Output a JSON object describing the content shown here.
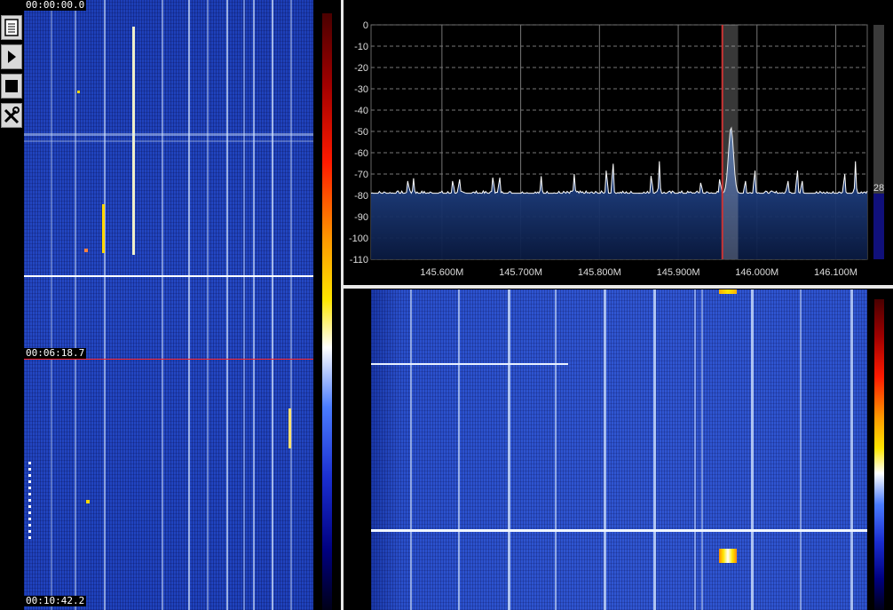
{
  "timestamps": {
    "t0": "00:00:00.0",
    "t1": "00:06:18.7",
    "t2": "00:10:42.2"
  },
  "toolbar": {
    "buttons": [
      {
        "name": "log-button",
        "icon": "document-icon"
      },
      {
        "name": "play-button",
        "icon": "play-icon"
      },
      {
        "name": "stop-button",
        "icon": "stop-icon"
      },
      {
        "name": "settings-button",
        "icon": "tools-icon"
      }
    ]
  },
  "spectrum": {
    "y_ticks": [
      "0",
      "-10",
      "-20",
      "-30",
      "-40",
      "-50",
      "-60",
      "-70",
      "-80",
      "-90",
      "-100",
      "-110"
    ],
    "x_ticks": [
      "145.600M",
      "145.700M",
      "145.800M",
      "145.900M",
      "146.000M",
      "146.100M"
    ],
    "level_value": "28",
    "selection_color": "#cc3333"
  },
  "chart_data": {
    "type": "line",
    "title": "",
    "xlabel": "",
    "ylabel": "",
    "xlim": [
      145.51,
      146.14
    ],
    "ylim": [
      -110,
      0
    ],
    "grid": true,
    "noise_floor_db": -79,
    "peaks": [
      {
        "freq": 145.557,
        "db": -72
      },
      {
        "freq": 145.564,
        "db": -72
      },
      {
        "freq": 145.614,
        "db": -72
      },
      {
        "freq": 145.622,
        "db": -71
      },
      {
        "freq": 145.665,
        "db": -70
      },
      {
        "freq": 145.673,
        "db": -70
      },
      {
        "freq": 145.726,
        "db": -71
      },
      {
        "freq": 145.768,
        "db": -70
      },
      {
        "freq": 145.809,
        "db": -66
      },
      {
        "freq": 145.817,
        "db": -62
      },
      {
        "freq": 145.866,
        "db": -69
      },
      {
        "freq": 145.876,
        "db": -64
      },
      {
        "freq": 145.929,
        "db": -73
      },
      {
        "freq": 145.953,
        "db": -71
      },
      {
        "freq": 145.967,
        "db": -48
      },
      {
        "freq": 145.985,
        "db": -72
      },
      {
        "freq": 145.997,
        "db": -66
      },
      {
        "freq": 146.039,
        "db": -72
      },
      {
        "freq": 146.051,
        "db": -66
      },
      {
        "freq": 146.057,
        "db": -72
      },
      {
        "freq": 146.111,
        "db": -68
      },
      {
        "freq": 146.125,
        "db": -64
      }
    ],
    "selection": {
      "start": 145.956,
      "end": 145.976
    }
  }
}
